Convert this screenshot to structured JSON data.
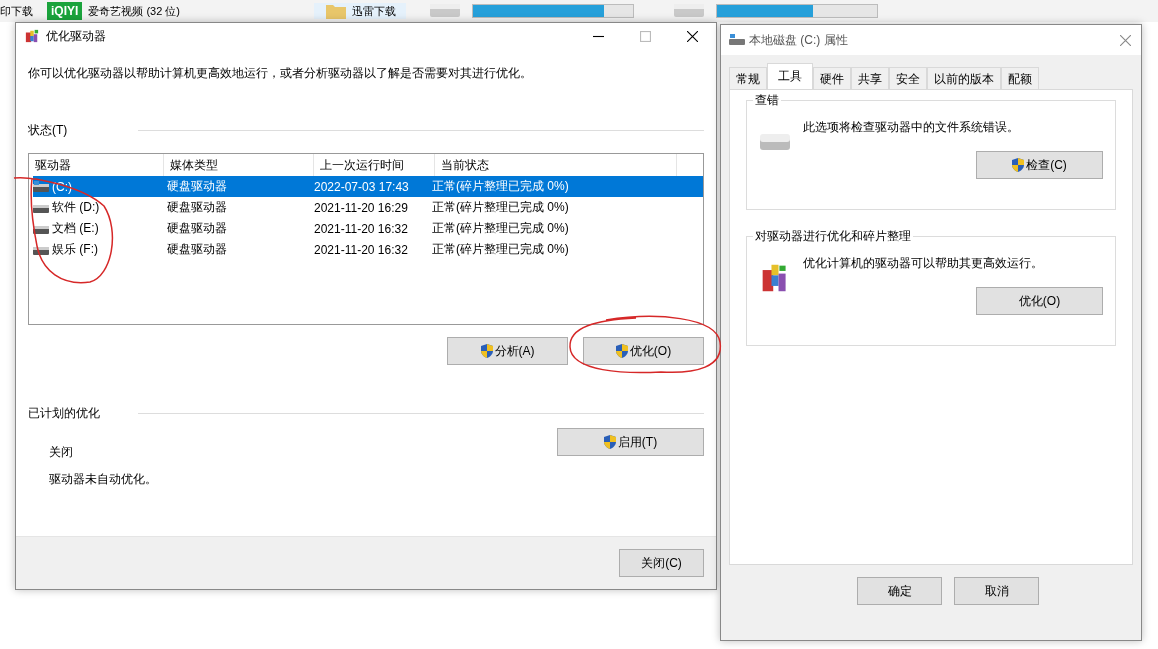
{
  "desktop": {
    "left_label": "印下载",
    "apps": [
      {
        "name": "爱奇艺视频 (32 位)",
        "kind": "iqiyi",
        "logo": "iQIYI"
      },
      {
        "name": "迅雷下载",
        "kind": "folder"
      }
    ],
    "drives": [
      {
        "level": 0.82
      },
      {
        "level": 0.6
      }
    ]
  },
  "optimize_dialog": {
    "title": "优化驱动器",
    "description": "你可以优化驱动器以帮助计算机更高效地运行，或者分析驱动器以了解是否需要对其进行优化。",
    "status_label": "状态(T)",
    "columns": [
      "驱动器",
      "媒体类型",
      "上一次运行时间",
      "当前状态"
    ],
    "rows": [
      {
        "drive": "(C:)",
        "kind": "system",
        "media": "硬盘驱动器",
        "last_run": "2022-07-03 17:43",
        "status": "正常(碎片整理已完成 0%)",
        "selected": true
      },
      {
        "drive": "软件 (D:)",
        "kind": "data",
        "media": "硬盘驱动器",
        "last_run": "2021-11-20 16:29",
        "status": "正常(碎片整理已完成 0%)",
        "selected": false
      },
      {
        "drive": "文档 (E:)",
        "kind": "data",
        "media": "硬盘驱动器",
        "last_run": "2021-11-20 16:32",
        "status": "正常(碎片整理已完成 0%)",
        "selected": false
      },
      {
        "drive": "娱乐 (F:)",
        "kind": "data",
        "media": "硬盘驱动器",
        "last_run": "2021-11-20 16:32",
        "status": "正常(碎片整理已完成 0%)",
        "selected": false
      }
    ],
    "buttons": [
      {
        "label": "分析(A)",
        "shield": true
      },
      {
        "label": "优化(O)",
        "shield": true
      }
    ],
    "scheduled": {
      "label": "已计划的优化",
      "state": "关闭",
      "note": "驱动器未自动优化。",
      "button": "启用(T)"
    },
    "close_button": "关闭(C)"
  },
  "properties_dialog": {
    "title": "本地磁盘 (C:) 属性",
    "tabs": [
      {
        "label": "常规",
        "selected": false
      },
      {
        "label": "工具",
        "selected": true
      },
      {
        "label": "硬件",
        "selected": false
      },
      {
        "label": "共享",
        "selected": false
      },
      {
        "label": "安全",
        "selected": false
      },
      {
        "label": "以前的版本",
        "selected": false
      },
      {
        "label": "配额",
        "selected": false
      }
    ],
    "groups": [
      {
        "title": "查错",
        "kind": "check",
        "text": "此选项将检查驱动器中的文件系统错误。",
        "button": "检查(C)",
        "shield": true
      },
      {
        "title": "对驱动器进行优化和碎片整理",
        "kind": "optimize",
        "text": "优化计算机的驱动器可以帮助其更高效运行。",
        "button": "优化(O)",
        "shield": false
      }
    ],
    "footer_buttons": [
      "确定",
      "取消"
    ]
  }
}
